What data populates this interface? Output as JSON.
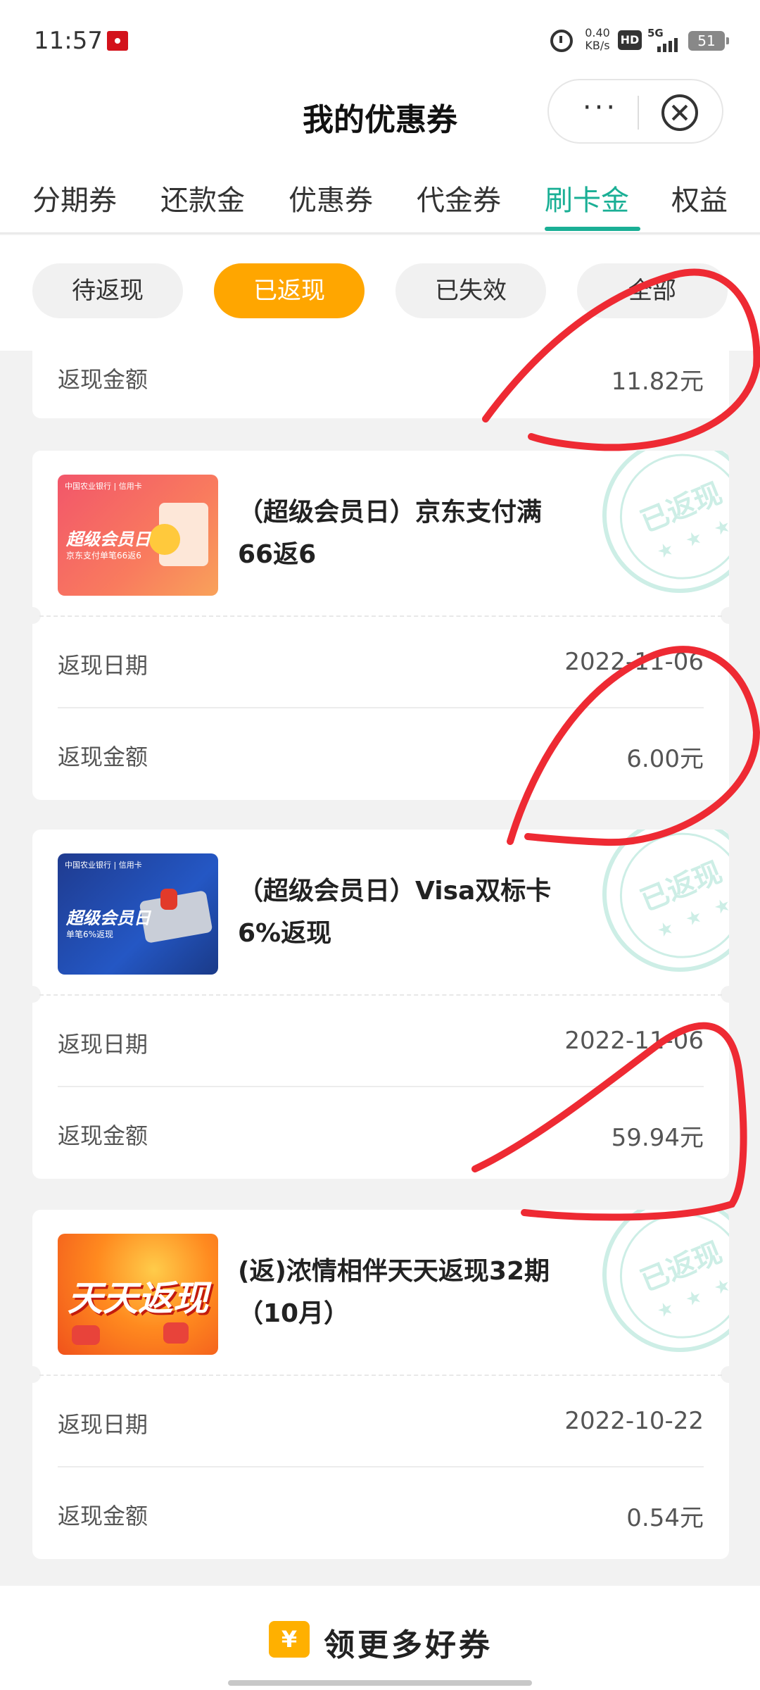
{
  "status_bar": {
    "time": "11:57",
    "net_speed_value": "0.40",
    "net_speed_unit": "KB/s",
    "hd_label": "HD",
    "network": "5G",
    "battery": "51"
  },
  "header": {
    "title": "我的优惠券",
    "more_label": "···"
  },
  "tabs": [
    "分期券",
    "还款金",
    "优惠券",
    "代金券",
    "刷卡金",
    "权益"
  ],
  "active_tab": "刷卡金",
  "filters": [
    "待返现",
    "已返现",
    "已失效",
    "全部"
  ],
  "active_filter": "已返现",
  "partial_card": {
    "amount_label": "返现金额",
    "amount": "11.82元"
  },
  "cards": [
    {
      "name": "（超级会员日）京东支付满66返6",
      "date_label": "返现日期",
      "date": "2022-11-06",
      "amount_label": "返现金额",
      "amount": "6.00元",
      "stamp": "已返现",
      "thumb": {
        "bank": "中国农业银行 | 信用卡",
        "headline": "超级会员日",
        "sub": "京东支付单笔66返6"
      }
    },
    {
      "name": "（超级会员日）Visa双标卡6%返现",
      "date_label": "返现日期",
      "date": "2022-11-06",
      "amount_label": "返现金额",
      "amount": "59.94元",
      "stamp": "已返现",
      "thumb": {
        "bank": "中国农业银行 | 信用卡",
        "headline": "超级会员日",
        "sub": "单笔6%返现"
      }
    },
    {
      "name": "(返)浓情相伴天天返现32期（10月）",
      "date_label": "返现日期",
      "date": "2022-10-22",
      "amount_label": "返现金额",
      "amount": "0.54元",
      "stamp": "已返现",
      "thumb": {
        "headline": "天天返现"
      }
    }
  ],
  "bottom": {
    "icon": "¥",
    "label": "领更多好券"
  },
  "colors": {
    "accent": "#1aaf95",
    "active_filter": "#ffa600",
    "scribble": "#ee2a33"
  }
}
